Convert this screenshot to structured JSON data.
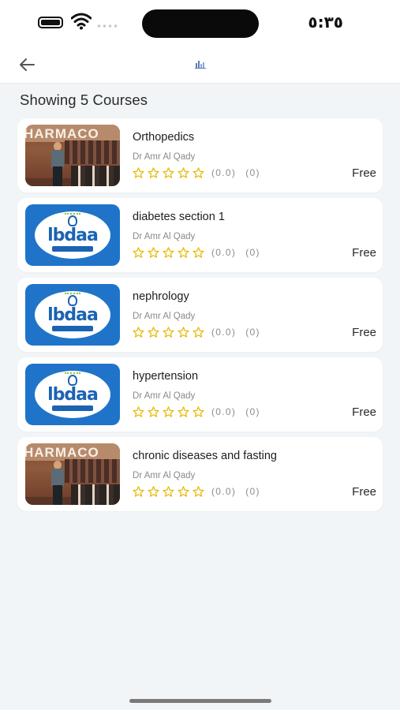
{
  "status_bar": {
    "time": "٥:٣٥"
  },
  "header": {
    "back_icon": "arrow-left-icon",
    "title_icon": "chart-icon"
  },
  "summary": "Showing 5 Courses",
  "courses": [
    {
      "title": "Orthopedics",
      "instructor": "Dr Amr Al Qady",
      "rating": "(0.0)",
      "reviews": "(0)",
      "price": "Free",
      "thumb": "lecture-photo",
      "thumb_text": "HARMACO"
    },
    {
      "title": "diabetes section 1",
      "instructor": "Dr Amr Al Qady",
      "rating": "(0.0)",
      "reviews": "(0)",
      "price": "Free",
      "thumb": "ibdaa-logo",
      "thumb_text": "IBDAA ACADEMY"
    },
    {
      "title": "nephrology",
      "instructor": "Dr Amr Al Qady",
      "rating": "(0.0)",
      "reviews": "(0)",
      "price": "Free",
      "thumb": "ibdaa-logo",
      "thumb_text": "IBDAA ACADEMY"
    },
    {
      "title": "hypertension",
      "instructor": "Dr Amr Al Qady",
      "rating": "(0.0)",
      "reviews": "(0)",
      "price": "Free",
      "thumb": "ibdaa-logo",
      "thumb_text": "IBDAA ACADEMY"
    },
    {
      "title": "chronic diseases and fasting",
      "instructor": "Dr Amr Al Qady",
      "rating": "(0.0)",
      "reviews": "(0)",
      "price": "Free",
      "thumb": "lecture-photo",
      "thumb_text": "HARMACO"
    }
  ],
  "colors": {
    "star": "#e6b800",
    "accent_blue": "#1f74c9",
    "background": "#f2f5f7"
  }
}
